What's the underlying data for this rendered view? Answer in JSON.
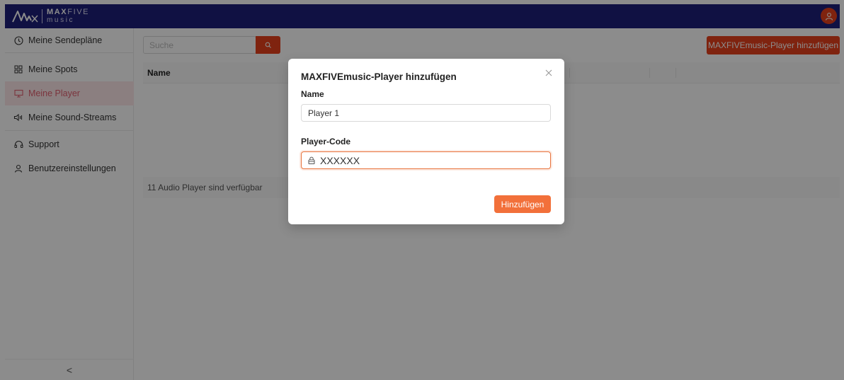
{
  "brand": {
    "logo_top_bold": "MAX",
    "logo_top_light": "FIVE",
    "logo_bottom": "music",
    "accent_color": "#e8401c",
    "header_color": "#1e1f7a"
  },
  "header": {
    "avatar_icon": "user-icon"
  },
  "sidebar": {
    "items": [
      {
        "label": "Meine Sendepläne",
        "icon": "clock-icon",
        "active": false
      },
      {
        "label": "Meine Spots",
        "icon": "grid-icon",
        "active": false
      },
      {
        "label": "Meine Player",
        "icon": "monitor-icon",
        "active": true
      },
      {
        "label": "Meine Sound-Streams",
        "icon": "speaker-icon",
        "active": false
      },
      {
        "label": "Support",
        "icon": "headset-icon",
        "active": false
      },
      {
        "label": "Benutzereinstellungen",
        "icon": "user-icon",
        "active": false
      }
    ],
    "collapse_label": "<"
  },
  "main": {
    "search_placeholder": "Suche",
    "add_button_label": "MAXFIVEmusic-Player hinzufügen",
    "table": {
      "columns": [
        "Name"
      ]
    },
    "footer_text": "11 Audio Player sind verfügbar"
  },
  "modal": {
    "title": "MAXFIVEmusic-Player hinzufügen",
    "name_label": "Name",
    "name_value": "Player 1",
    "code_label": "Player-Code",
    "code_value": "XXXXXX",
    "submit_label": "Hinzufügen"
  }
}
